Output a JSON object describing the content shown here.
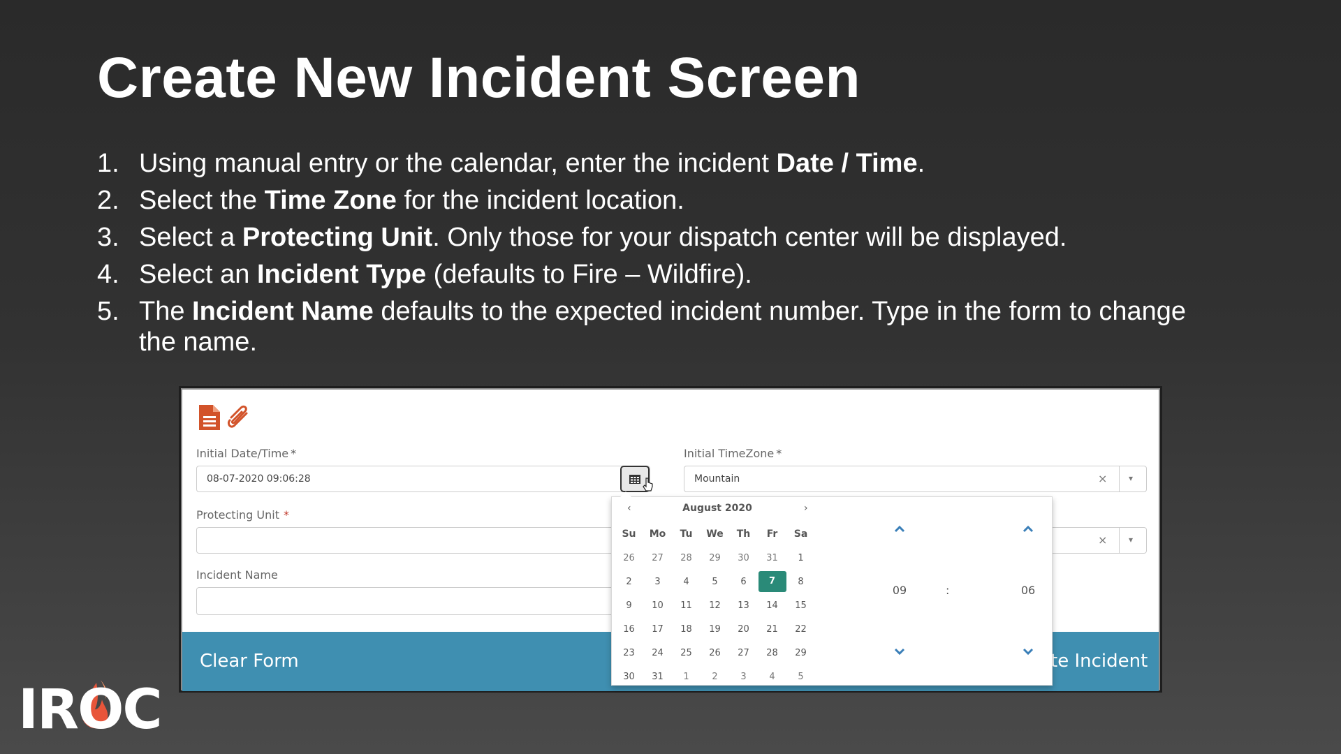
{
  "slide": {
    "title": "Create New Incident Screen",
    "steps": [
      {
        "num": "1.",
        "parts": [
          "Using manual entry or the calendar, enter the incident ",
          "Date / Time",
          "."
        ]
      },
      {
        "num": "2.",
        "parts": [
          "Select the ",
          "Time Zone",
          " for the incident location."
        ]
      },
      {
        "num": "3.",
        "parts": [
          "Select a ",
          "Protecting Unit",
          ". Only those for your dispatch center will be displayed."
        ]
      },
      {
        "num": "4.",
        "parts": [
          "Select an ",
          "Incident Type",
          " (defaults to Fire – Wildfire)."
        ]
      },
      {
        "num": "5.",
        "parts": [
          "The ",
          "Incident Name",
          " defaults to the expected incident number. Type in the form to change the name."
        ]
      }
    ]
  },
  "form": {
    "initial_datetime_label": "Initial Date/Time",
    "initial_datetime_value": "08-07-2020 09:06:28",
    "initial_timezone_label": "Initial TimeZone",
    "initial_timezone_value": "Mountain",
    "protecting_unit_label": "Protecting Unit",
    "protecting_unit_value": "",
    "incident_name_label": "Incident Name",
    "incident_name_value": "",
    "required_mark": "*",
    "clear_symbol": "×",
    "caret_symbol": "▾"
  },
  "footer": {
    "clear_form": "Clear Form",
    "create_incident_partial": "te Incident"
  },
  "datepicker": {
    "prev": "‹",
    "next": "›",
    "month_label": "August 2020",
    "weekdays": [
      "Su",
      "Mo",
      "Tu",
      "We",
      "Th",
      "Fr",
      "Sa"
    ],
    "weeks": [
      [
        "26",
        "27",
        "28",
        "29",
        "30",
        "31",
        "1"
      ],
      [
        "2",
        "3",
        "4",
        "5",
        "6",
        "7",
        "8"
      ],
      [
        "9",
        "10",
        "11",
        "12",
        "13",
        "14",
        "15"
      ],
      [
        "16",
        "17",
        "18",
        "19",
        "20",
        "21",
        "22"
      ],
      [
        "23",
        "24",
        "25",
        "26",
        "27",
        "28",
        "29"
      ],
      [
        "30",
        "31",
        "1",
        "2",
        "3",
        "4",
        "5"
      ]
    ],
    "other_month_flags": [
      [
        true,
        true,
        true,
        true,
        true,
        true,
        false
      ],
      [
        false,
        false,
        false,
        false,
        false,
        false,
        false
      ],
      [
        false,
        false,
        false,
        false,
        false,
        false,
        false
      ],
      [
        false,
        false,
        false,
        false,
        false,
        false,
        false
      ],
      [
        false,
        false,
        false,
        false,
        false,
        false,
        false
      ],
      [
        false,
        false,
        true,
        true,
        true,
        true,
        true
      ]
    ],
    "selected_day": "7",
    "hour": "09",
    "minute": "06",
    "time_separator": ":"
  },
  "logo": {
    "text": "IROC"
  },
  "colors": {
    "accent_teal": "#2a8a78",
    "footer_blue": "#3f8fb1",
    "icon_orange": "#d2532a",
    "chevron_blue": "#3a7fb8"
  },
  "icons": [
    "document-icon",
    "paperclip-icon",
    "calendar-icon",
    "chevron-up-icon",
    "chevron-down-icon"
  ]
}
